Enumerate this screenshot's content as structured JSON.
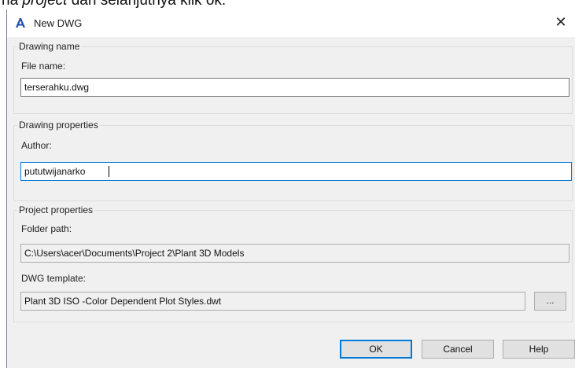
{
  "caption": {
    "pre": "na ",
    "italic": "project",
    "post": " dan selanjutnya klik ok."
  },
  "window": {
    "title": "New DWG",
    "app_icon": "autocad-icon",
    "close_glyph": "✕"
  },
  "drawing_name": {
    "legend": "Drawing name",
    "file_name_label": "File name:",
    "file_name_value": "terserahku.dwg"
  },
  "drawing_properties": {
    "legend": "Drawing properties",
    "author_label": "Author:",
    "author_value": "pututwijanarko"
  },
  "project_properties": {
    "legend": "Project properties",
    "folder_path_label": "Folder path:",
    "folder_path_value": "C:\\Users\\acer\\Documents\\Project 2\\Plant 3D Models",
    "dwg_template_label": "DWG template:",
    "dwg_template_value": "Plant 3D ISO -Color Dependent Plot Styles.dwt",
    "browse_label": "..."
  },
  "buttons": {
    "ok": "OK",
    "cancel": "Cancel",
    "help": "Help"
  },
  "colors": {
    "dialog_bg": "#f0f0f0",
    "focus_border": "#0078d7",
    "app_icon": "#1f4fa8"
  }
}
